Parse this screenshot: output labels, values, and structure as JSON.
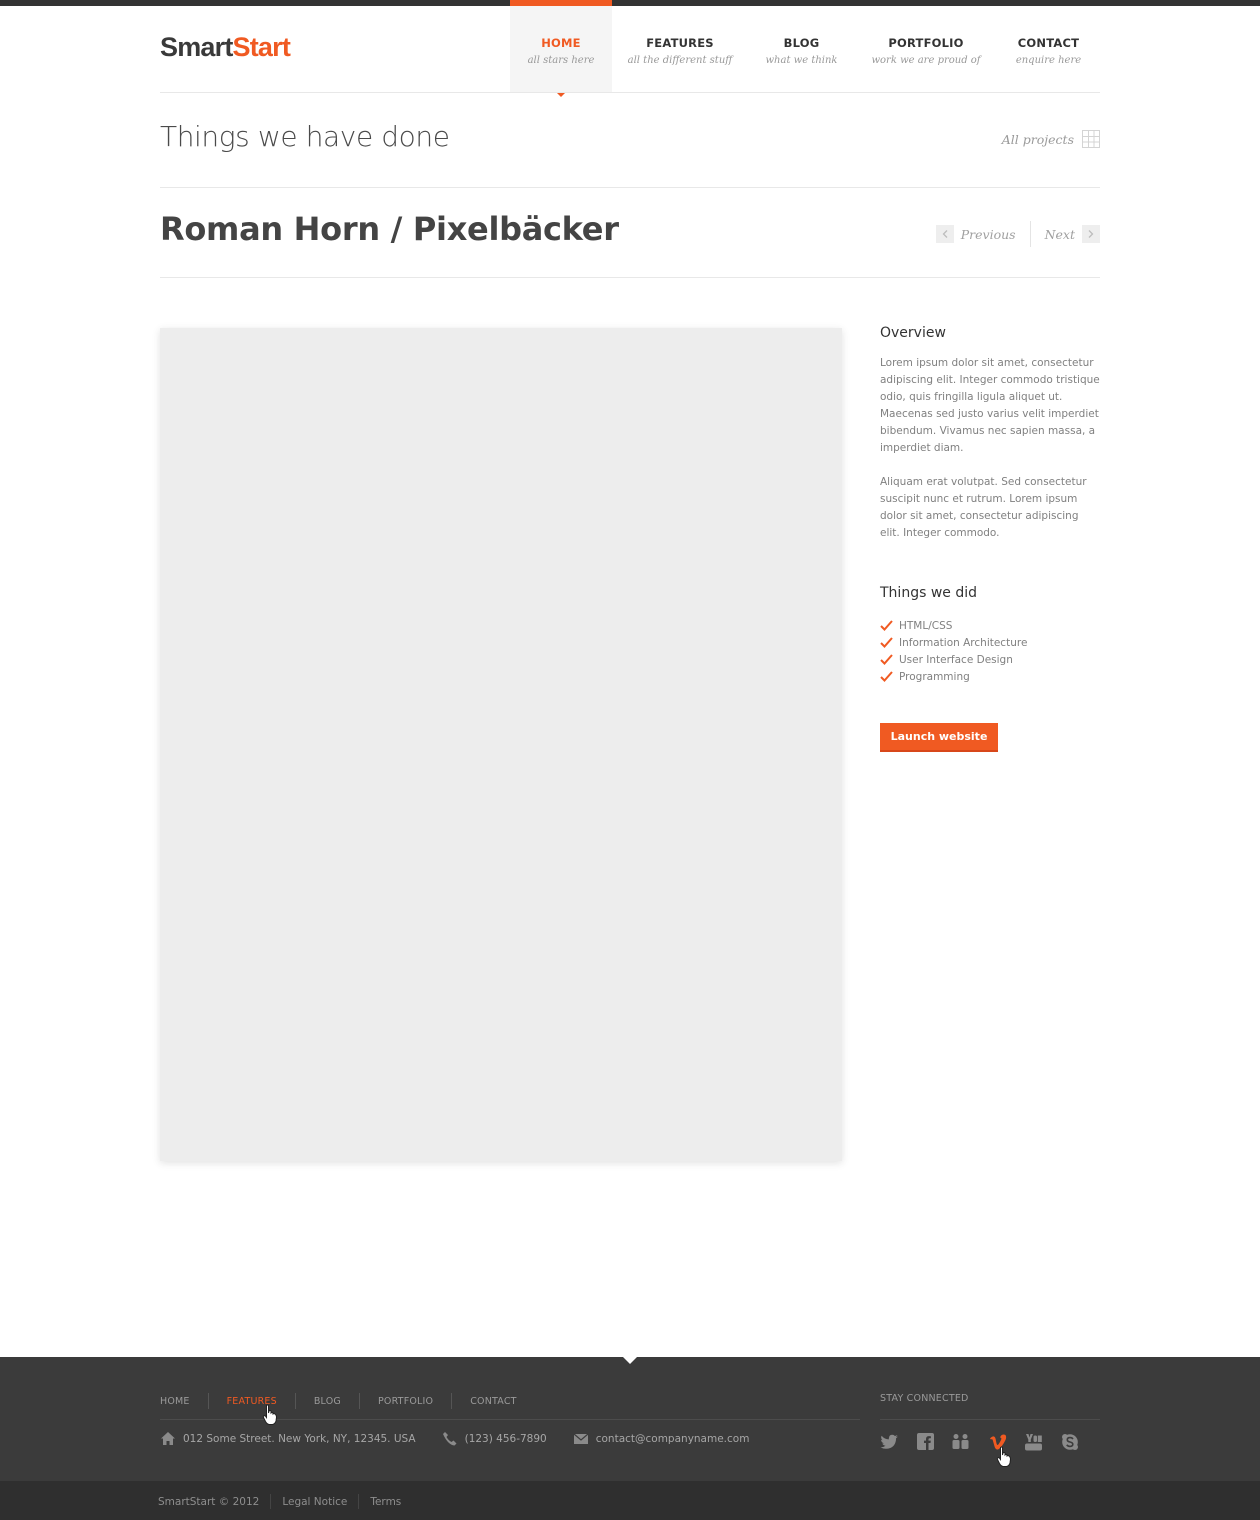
{
  "brand": {
    "part1": "Smart",
    "part2": "Start"
  },
  "nav": [
    {
      "label": "HOME",
      "sub": "all stars here",
      "active": true
    },
    {
      "label": "FEATURES",
      "sub": "all the different stuff"
    },
    {
      "label": "BLOG",
      "sub": "what we think"
    },
    {
      "label": "PORTFOLIO",
      "sub": "work we are proud of"
    },
    {
      "label": "CONTACT",
      "sub": "enquire here"
    }
  ],
  "page": {
    "title": "Things we have done",
    "all_projects": "All projects",
    "project_title": "Roman Horn / Pixelbäcker",
    "previous": "Previous",
    "next": "Next"
  },
  "overview": {
    "heading": "Overview",
    "p1": "Lorem ipsum dolor sit amet, consectetur adipiscing elit. Integer commodo tristique odio, quis fringilla ligula aliquet ut. Maecenas sed justo varius velit imperdiet bibendum. Vivamus nec sapien massa, a imperdiet diam.",
    "p2": "Aliquam erat volutpat. Sed consectetur suscipit nunc et rutrum. Lorem ipsum dolor sit amet, consectetur adipiscing elit. Integer commodo."
  },
  "things": {
    "heading": "Things we did",
    "items": [
      "HTML/CSS",
      "Information Architecture",
      "User Interface Design",
      "Programming"
    ]
  },
  "launch_label": "Launch website",
  "footer": {
    "nav": [
      "HOME",
      "FEATURES",
      "BLOG",
      "PORTFOLIO",
      "CONTACT"
    ],
    "highlighted": "FEATURES",
    "address": "012 Some Street. New York, NY, 12345. USA",
    "phone": "(123) 456-7890",
    "email": "contact@companyname.com",
    "stay_connected": "STAY CONNECTED",
    "social": [
      "twitter-icon",
      "facebook-icon",
      "flickr-icon",
      "vimeo-icon",
      "youtube-icon",
      "skype-icon"
    ],
    "copyright": "SmartStart © 2012",
    "legal": "Legal Notice",
    "terms": "Terms"
  },
  "colors": {
    "accent": "#f05a22",
    "footer": "#3b3b3b",
    "bottombar": "#2f2f2f"
  }
}
